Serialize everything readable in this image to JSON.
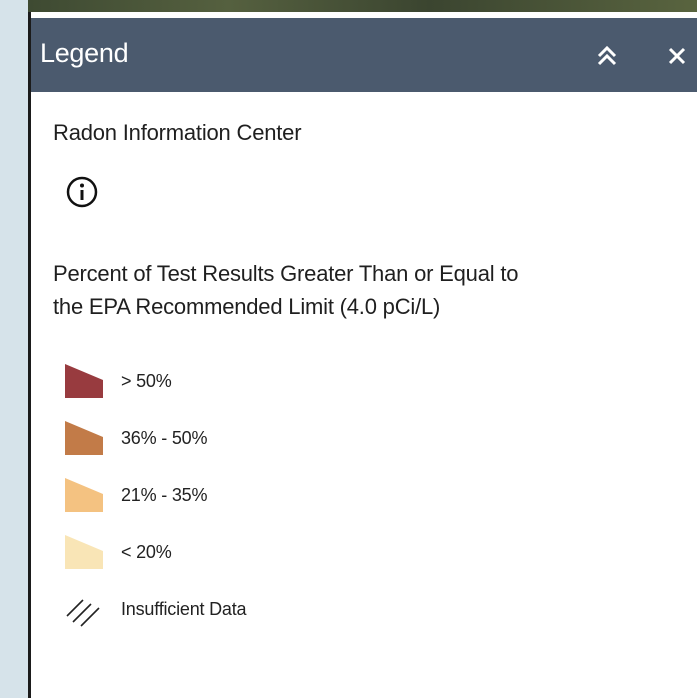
{
  "header": {
    "title": "Legend",
    "collapse_icon": "double-chevron-up-icon",
    "close_icon": "close-icon"
  },
  "layer": {
    "title": "Radon Information Center",
    "info_icon": "info-icon"
  },
  "field": {
    "title_line1": "Percent of Test Results Greater Than or Equal to",
    "title_line2": "the EPA Recommended Limit (4.0 pCi/L)"
  },
  "legend": {
    "items": [
      {
        "label": "> 50%",
        "color": "#983b3f"
      },
      {
        "label": "36% - 50%",
        "color": "#c27b48"
      },
      {
        "label": "21% - 35%",
        "color": "#f4c281"
      },
      {
        "label": "< 20%",
        "color": "#f9e5b6"
      },
      {
        "label": "Insufficient Data",
        "color": "hatch",
        "icon": "hatch-icon"
      }
    ]
  },
  "colors": {
    "header_bg": "#4b5a6e",
    "page_bg": "#d6e3ea"
  }
}
